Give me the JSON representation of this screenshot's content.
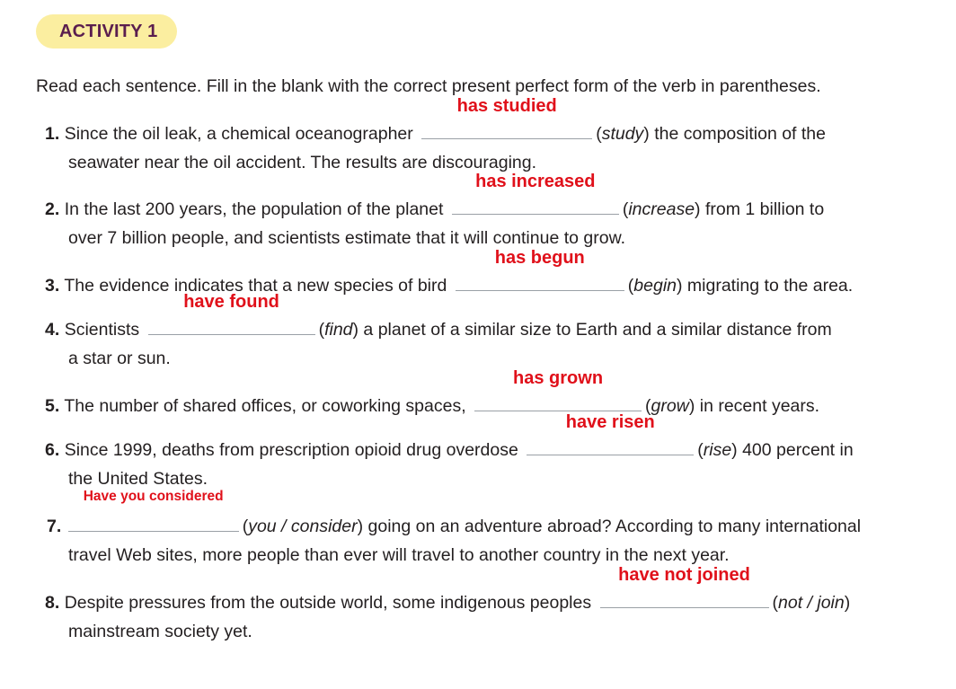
{
  "activity_label": "ACTIVITY 1",
  "instructions": "Read each sentence. Fill in the blank with the correct present perfect form of the verb in parentheses.",
  "items": [
    {
      "num": "1.",
      "before": "Since the oil leak, a chemical oceanographer",
      "answer": "has studied",
      "verb": "study",
      "after": " the composition of the",
      "line2": "seawater near the oil accident. The results are discouraging."
    },
    {
      "num": "2.",
      "before": "In the last 200 years, the population of the planet",
      "answer": "has increased",
      "verb": "increase",
      "after": " from 1 billion to",
      "line2": "over 7 billion people, and scientists estimate that it will continue to grow."
    },
    {
      "num": "3.",
      "before": "The evidence indicates that a new species of bird",
      "answer": "has begun",
      "verb": "begin",
      "after": " migrating to the area."
    },
    {
      "num": "4.",
      "before": "Scientists",
      "answer": "have found",
      "verb": "find",
      "after": " a planet of a similar size to Earth and a similar distance from",
      "line2": "a star or sun."
    },
    {
      "num": "5.",
      "before": "The number of shared offices, or coworking spaces,",
      "answer": "has grown",
      "verb": "grow",
      "after": " in recent years."
    },
    {
      "num": "6.",
      "before": "Since 1999, deaths from prescription opioid drug overdose",
      "answer": "have risen",
      "verb": "rise",
      "after": " 400 percent in",
      "line2": "the United States."
    },
    {
      "num": "7.",
      "before": "",
      "answer": "Have you considered",
      "verb": "you / consider",
      "after": " going on an adventure abroad? According to many international",
      "line2": "travel Web sites, more people than ever will travel to another country in the next year."
    },
    {
      "num": "8.",
      "before": "Despite pressures from the outside world, some indigenous peoples",
      "answer": "have not joined",
      "verb": "not / join",
      "after": "",
      "line2": "mainstream society yet."
    }
  ],
  "colors": {
    "badge_bg": "#fbeea0",
    "badge_text": "#5a1e4e",
    "answer": "#e0101a",
    "text": "#231f20"
  }
}
